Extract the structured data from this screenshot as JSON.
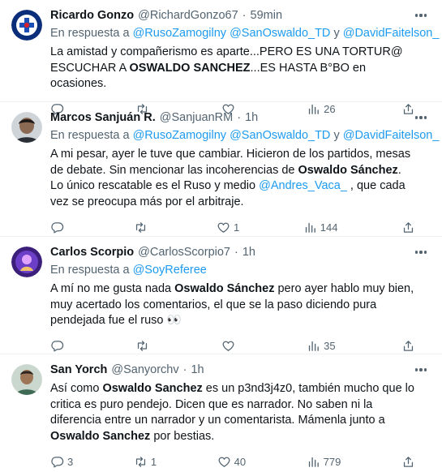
{
  "reply_prefix": "En respuesta a",
  "tweets": [
    {
      "name": "Ricardo Gonzo",
      "handle": "@RichardGonzo67",
      "separator": "·",
      "time": "59min",
      "mentions": [
        "@RusoZamogilny",
        "@SanOswaldo_TD",
        "@DavidFaitelson_"
      ],
      "connector": "y",
      "body": {
        "t1": "La amistad y compañerismo es aparte...PERO ES UNA TORTUR@ ESCUCHAR A ",
        "b1": "OSWALDO SANCHEZ",
        "t2": "...ES HASTA B°BO en ocasiones."
      },
      "stats": {
        "replies": "",
        "retweets": "",
        "likes": "",
        "views": "26"
      }
    },
    {
      "name": "Marcos Sanjuán R.",
      "handle": "@SanjuanRM",
      "separator": "·",
      "time": "1h",
      "mentions": [
        "@RusoZamogilny",
        "@SanOswaldo_TD",
        "@DavidFaitelson_"
      ],
      "connector": "y",
      "body": {
        "t1": "A mi pesar, ayer le tuve que cambiar. Hicieron de los partidos, mesas de debate. Sin mencionar las incoherencias de ",
        "b1": "Oswaldo Sánchez",
        "t2": ". Lo único rescatable es el Ruso y medio ",
        "m1": "@Andres_Vaca_",
        "t3": " , que cada vez se preocupa más por el arbitraje."
      },
      "stats": {
        "replies": "",
        "retweets": "",
        "likes": "1",
        "views": "144"
      }
    },
    {
      "name": "Carlos Scorpio",
      "handle": "@CarlosScorpio7",
      "separator": "·",
      "time": "1h",
      "mentions": [
        "@SoyReferee"
      ],
      "body": {
        "t1": "A mí no me gusta nada ",
        "b1": "Oswaldo Sánchez",
        "t2": " pero ayer hablo muy bien, muy acertado los comentarios, el que se la paso diciendo pura pendejada fue el ruso 👀"
      },
      "stats": {
        "replies": "",
        "retweets": "",
        "likes": "",
        "views": "35"
      }
    },
    {
      "name": "San Yorch",
      "handle": "@Sanyorchv",
      "separator": "·",
      "time": "1h",
      "body": {
        "t1": "Así como ",
        "b1": "Oswaldo Sanchez",
        "t2": " es un p3nd3j4z0, también mucho que lo critica es puro pendejo. Dicen que es narrador. No saben ni la diferencia entre un narrador y un comentarista. Mámenla junto a ",
        "b2": "Oswaldo Sanchez",
        "t3": " por bestias."
      },
      "stats": {
        "replies": "3",
        "retweets": "1",
        "likes": "40",
        "views": "779"
      }
    }
  ],
  "icons": {
    "reply": "reply-icon",
    "retweet": "retweet-icon",
    "like": "heart-icon",
    "views": "views-icon",
    "share": "share-icon",
    "more": "more-icon"
  },
  "colors": {
    "link": "#1d9bf0",
    "muted": "#536471",
    "text": "#0f1419",
    "divider": "#eff3f4"
  }
}
